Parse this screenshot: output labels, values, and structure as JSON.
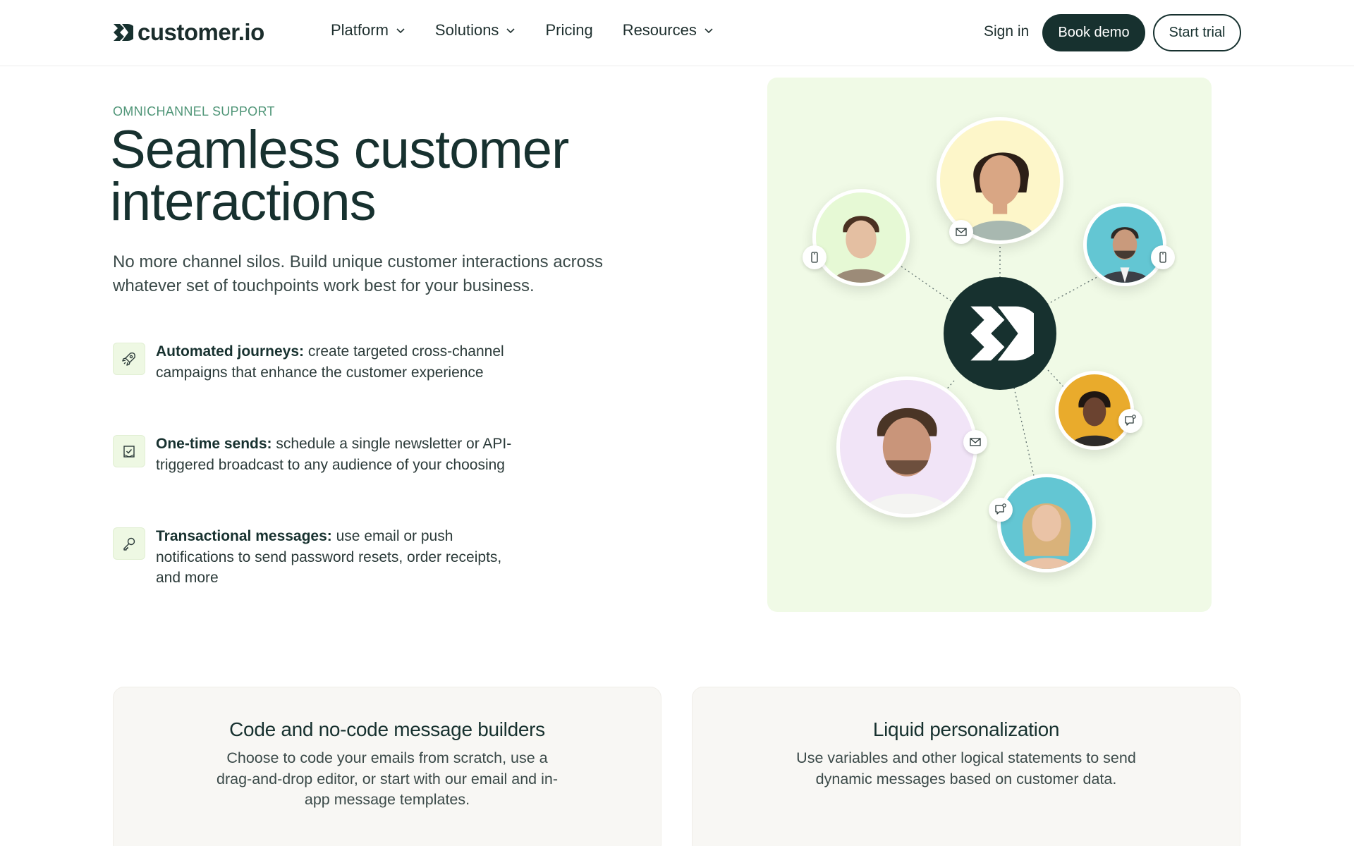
{
  "brand": {
    "name": "customer.io",
    "accent": "#17312f",
    "eyebrow_color": "#4f9577",
    "illustration_bg": "#f0fae6"
  },
  "nav": {
    "items": [
      {
        "label": "Platform",
        "has_dropdown": true
      },
      {
        "label": "Solutions",
        "has_dropdown": true
      },
      {
        "label": "Pricing",
        "has_dropdown": false
      },
      {
        "label": "Resources",
        "has_dropdown": true
      }
    ],
    "sign_in": "Sign in",
    "book_demo": "Book demo",
    "start_trial": "Start trial"
  },
  "hero": {
    "eyebrow": "OMNICHANNEL SUPPORT",
    "title": "Seamless customer interactions",
    "lede": "No more channel silos. Build unique customer interactions across whatever set of touchpoints work best for your business.",
    "features": [
      {
        "icon": "rocket-icon",
        "bold": "Automated journeys:",
        "text": " create targeted cross-channel campaigns that enhance the customer experience"
      },
      {
        "icon": "calendar-check-icon",
        "bold": "One-time sends:",
        "text": " schedule a single newsletter or API-triggered broadcast to any audience of your choosing"
      },
      {
        "icon": "key-icon",
        "bold": "Transactional messages:",
        "text": " use email or push notifications to send password resets, order receipts, and more"
      }
    ]
  },
  "illustration": {
    "hub_icon": "customerio-logo-icon",
    "people": [
      {
        "name": "woman-short-hair",
        "bg": "#fdf6c9",
        "channel": "mail-icon"
      },
      {
        "name": "young-man-glasses",
        "bg": "#e6f9d5",
        "channel": "phone-icon"
      },
      {
        "name": "man-beard-suit",
        "bg": "#63c6d3",
        "channel": "phone-icon"
      },
      {
        "name": "man-curly-hair",
        "bg": "#f1e4f7",
        "channel": "mail-icon"
      },
      {
        "name": "man-locs",
        "bg": "#e9ab2c",
        "channel": "chat-icon"
      },
      {
        "name": "woman-blonde",
        "bg": "#63c6d3",
        "channel": "chat-icon"
      }
    ]
  },
  "cards": [
    {
      "title": "Code and no-code message builders",
      "body": "Choose to code your emails from scratch, use a drag-and-drop editor, or start with our email and in-app message templates."
    },
    {
      "title": "Liquid personalization",
      "body": "Use variables and other logical statements to send dynamic messages based on customer data."
    }
  ]
}
